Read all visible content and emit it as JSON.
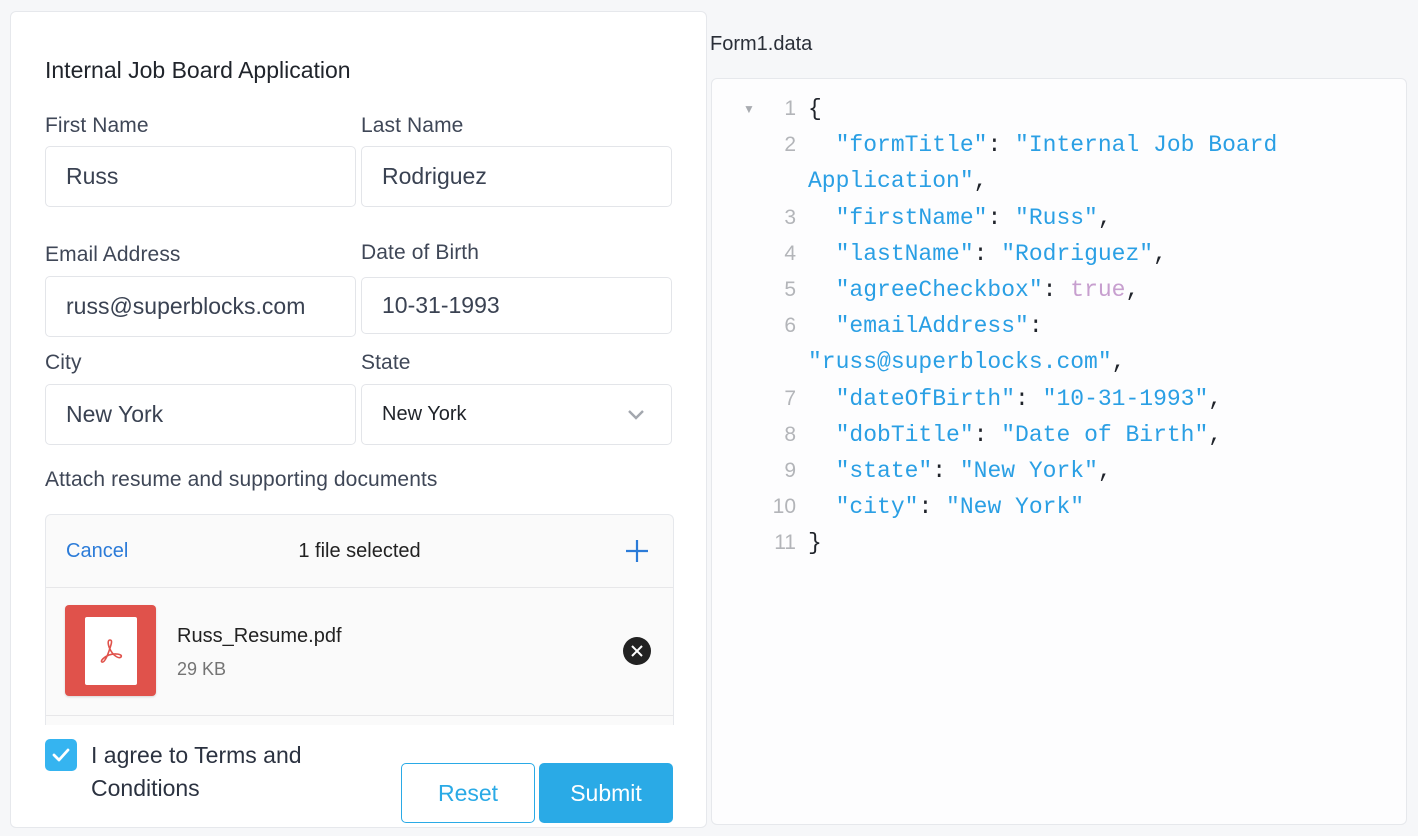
{
  "form": {
    "title": "Internal Job Board Application",
    "fields": {
      "first_name": {
        "label": "First Name",
        "value": "Russ"
      },
      "last_name": {
        "label": "Last Name",
        "value": "Rodriguez"
      },
      "email": {
        "label": "Email Address",
        "value": "russ@superblocks.com"
      },
      "dob": {
        "label": "Date of Birth",
        "value": "10-31-1993"
      },
      "city": {
        "label": "City",
        "value": "New York"
      },
      "state": {
        "label": "State",
        "value": "New York"
      }
    },
    "upload": {
      "label": "Attach resume and supporting documents",
      "cancel_label": "Cancel",
      "count_text": "1 file selected",
      "files": [
        {
          "name": "Russ_Resume.pdf",
          "size": "29 KB",
          "icon": "pdf-icon"
        }
      ]
    },
    "agree": {
      "checked": true,
      "label": "I agree to Terms and Conditions"
    },
    "buttons": {
      "reset": "Reset",
      "submit": "Submit"
    },
    "colors": {
      "accent": "#2aaae6",
      "link": "#2b7bd8",
      "pdf": "#e0524b"
    }
  },
  "json_view": {
    "heading": "Form1.data",
    "lines": [
      {
        "n": "1",
        "fold": true,
        "parts": [
          [
            "p",
            "{"
          ]
        ]
      },
      {
        "n": "2",
        "parts": [
          [
            "p",
            "  "
          ],
          [
            "k",
            "\"formTitle\""
          ],
          [
            "p",
            ": "
          ],
          [
            "s",
            "\"Internal Job Board Application\""
          ],
          [
            "p",
            ","
          ]
        ]
      },
      {
        "n": "3",
        "parts": [
          [
            "p",
            "  "
          ],
          [
            "k",
            "\"firstName\""
          ],
          [
            "p",
            ": "
          ],
          [
            "s",
            "\"Russ\""
          ],
          [
            "p",
            ","
          ]
        ]
      },
      {
        "n": "4",
        "parts": [
          [
            "p",
            "  "
          ],
          [
            "k",
            "\"lastName\""
          ],
          [
            "p",
            ": "
          ],
          [
            "s",
            "\"Rodriguez\""
          ],
          [
            "p",
            ","
          ]
        ]
      },
      {
        "n": "5",
        "parts": [
          [
            "p",
            "  "
          ],
          [
            "k",
            "\"agreeCheckbox\""
          ],
          [
            "p",
            ": "
          ],
          [
            "b",
            "true"
          ],
          [
            "p",
            ","
          ]
        ]
      },
      {
        "n": "6",
        "parts": [
          [
            "p",
            "  "
          ],
          [
            "k",
            "\"emailAddress\""
          ],
          [
            "p",
            ": "
          ],
          [
            "s",
            "\"russ@superblocks.com\""
          ],
          [
            "p",
            ","
          ]
        ]
      },
      {
        "n": "7",
        "parts": [
          [
            "p",
            "  "
          ],
          [
            "k",
            "\"dateOfBirth\""
          ],
          [
            "p",
            ": "
          ],
          [
            "s",
            "\"10-31-1993\""
          ],
          [
            "p",
            ","
          ]
        ]
      },
      {
        "n": "8",
        "parts": [
          [
            "p",
            "  "
          ],
          [
            "k",
            "\"dobTitle\""
          ],
          [
            "p",
            ": "
          ],
          [
            "s",
            "\"Date of Birth\""
          ],
          [
            "p",
            ","
          ]
        ]
      },
      {
        "n": "9",
        "parts": [
          [
            "p",
            "  "
          ],
          [
            "k",
            "\"state\""
          ],
          [
            "p",
            ": "
          ],
          [
            "s",
            "\"New York\""
          ],
          [
            "p",
            ","
          ]
        ]
      },
      {
        "n": "10",
        "parts": [
          [
            "p",
            "  "
          ],
          [
            "k",
            "\"city\""
          ],
          [
            "p",
            ": "
          ],
          [
            "s",
            "\"New York\""
          ]
        ]
      },
      {
        "n": "11",
        "parts": [
          [
            "p",
            "}"
          ]
        ]
      }
    ]
  }
}
